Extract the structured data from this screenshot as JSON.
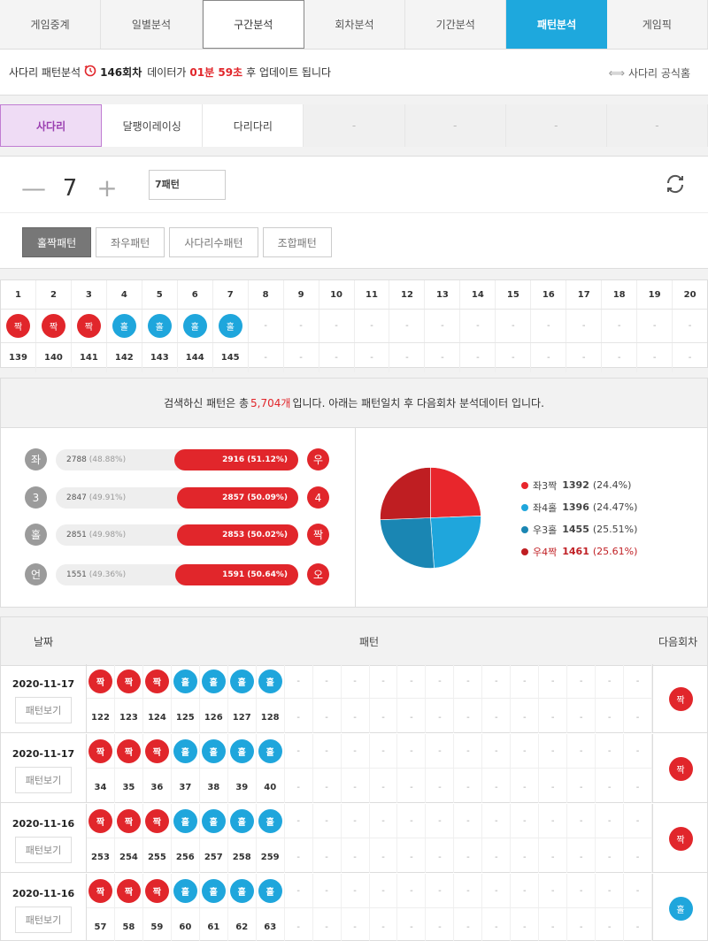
{
  "main_tabs": [
    {
      "label": "게임중계",
      "state": "normal"
    },
    {
      "label": "일별분석",
      "state": "normal"
    },
    {
      "label": "구간분석",
      "state": "selected"
    },
    {
      "label": "회차분석",
      "state": "normal"
    },
    {
      "label": "기간분석",
      "state": "normal"
    },
    {
      "label": "패턴분석",
      "state": "active"
    },
    {
      "label": "게임픽",
      "state": "normal"
    }
  ],
  "info": {
    "prefix": "사다리 패턴분석",
    "round": "146회차",
    "mid": "데이터가",
    "time": "01분 59초",
    "suffix": "후 업데이트 됩니다",
    "official_link": "사다리 공식홈"
  },
  "sub_tabs": [
    "사다리",
    "달팽이레이싱",
    "다리다리",
    "-",
    "-",
    "-",
    "-"
  ],
  "controls": {
    "minus": "—",
    "count": "7",
    "plus": "+",
    "pattern_value": "7패턴",
    "type_buttons": [
      "홀짝패턴",
      "좌우패턴",
      "사다리수패턴",
      "조합패턴"
    ]
  },
  "pattern_grid": {
    "cols": [
      "1",
      "2",
      "3",
      "4",
      "5",
      "6",
      "7",
      "8",
      "9",
      "10",
      "11",
      "12",
      "13",
      "14",
      "15",
      "16",
      "17",
      "18",
      "19",
      "20"
    ],
    "balls": [
      "짝",
      "짝",
      "짝",
      "홀",
      "홀",
      "홀",
      "홀",
      "-",
      "-",
      "-",
      "-",
      "-",
      "-",
      "-",
      "-",
      "-",
      "-",
      "-",
      "-",
      "-"
    ],
    "rounds": [
      "139",
      "140",
      "141",
      "142",
      "143",
      "144",
      "145",
      "-",
      "-",
      "-",
      "-",
      "-",
      "-",
      "-",
      "-",
      "-",
      "-",
      "-",
      "-",
      "-"
    ]
  },
  "summary": {
    "pre": "검색하신 패턴은 총",
    "count": "5,704개",
    "post": "입니다. 아래는 패턴일치 후 다음회차 분석데이터 입니다."
  },
  "bars": [
    {
      "left_label": "좌",
      "left_count": "2788",
      "left_pct": "(48.88%)",
      "right_count": "2916",
      "right_pct": "(51.12%)",
      "right_label": "우",
      "right_share": 51.12
    },
    {
      "left_label": "3",
      "left_count": "2847",
      "left_pct": "(49.91%)",
      "right_count": "2857",
      "right_pct": "(50.09%)",
      "right_label": "4",
      "right_share": 50.09
    },
    {
      "left_label": "홀",
      "left_count": "2851",
      "left_pct": "(49.98%)",
      "right_count": "2853",
      "right_pct": "(50.02%)",
      "right_label": "짝",
      "right_share": 50.02
    },
    {
      "left_label": "언",
      "left_count": "1551",
      "left_pct": "(49.36%)",
      "right_count": "1591",
      "right_pct": "(50.64%)",
      "right_label": "오",
      "right_share": 50.64
    }
  ],
  "chart_data": {
    "type": "pie",
    "slices": [
      {
        "label": "좌3짝",
        "value": 1392,
        "pct": "(24.4%)",
        "color": "#e8262c"
      },
      {
        "label": "좌4홀",
        "value": 1396,
        "pct": "(24.47%)",
        "color": "#1fa6dc"
      },
      {
        "label": "우3홀",
        "value": 1455,
        "pct": "(25.51%)",
        "color": "#1a86b3"
      },
      {
        "label": "우4짝",
        "value": 1461,
        "pct": "(25.61%)",
        "color": "#bf1e22"
      }
    ]
  },
  "history": {
    "headers": {
      "date": "날짜",
      "pattern": "패턴",
      "next": "다음회차"
    },
    "view_label": "패턴보기",
    "rows": [
      {
        "date": "2020-11-17",
        "balls": [
          "짝",
          "짝",
          "짝",
          "홀",
          "홀",
          "홀",
          "홀"
        ],
        "rounds": [
          "122",
          "123",
          "124",
          "125",
          "126",
          "127",
          "128"
        ],
        "next": "짝"
      },
      {
        "date": "2020-11-17",
        "balls": [
          "짝",
          "짝",
          "짝",
          "홀",
          "홀",
          "홀",
          "홀"
        ],
        "rounds": [
          "34",
          "35",
          "36",
          "37",
          "38",
          "39",
          "40"
        ],
        "next": "짝"
      },
      {
        "date": "2020-11-16",
        "balls": [
          "짝",
          "짝",
          "짝",
          "홀",
          "홀",
          "홀",
          "홀"
        ],
        "rounds": [
          "253",
          "254",
          "255",
          "256",
          "257",
          "258",
          "259"
        ],
        "next": "짝"
      },
      {
        "date": "2020-11-16",
        "balls": [
          "짝",
          "짝",
          "짝",
          "홀",
          "홀",
          "홀",
          "홀"
        ],
        "rounds": [
          "57",
          "58",
          "59",
          "60",
          "61",
          "62",
          "63"
        ],
        "next": "홀"
      }
    ]
  }
}
